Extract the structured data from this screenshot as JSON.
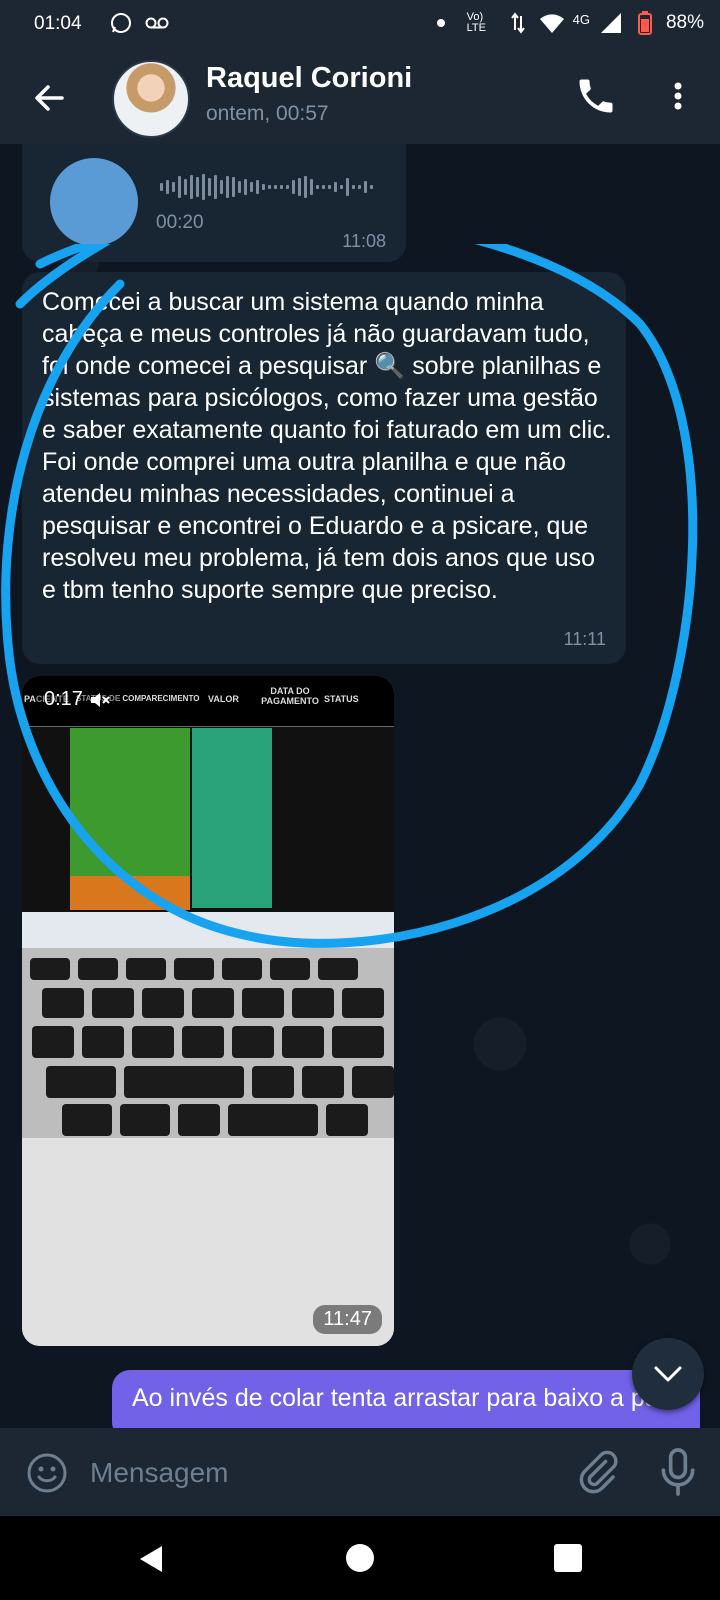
{
  "status_bar": {
    "time": "01:04",
    "network_label": "Vo) LTE",
    "signal_label": "4G",
    "battery": "88%"
  },
  "header": {
    "contact_name": "Raquel Corioni",
    "last_seen": "ontem, 00:57",
    "icons": [
      "back-arrow-icon",
      "phone-icon",
      "more-vertical-icon"
    ]
  },
  "messages": [
    {
      "type": "voice",
      "direction": "incoming",
      "duration": "00:20",
      "time": "11:08"
    },
    {
      "type": "text",
      "direction": "incoming",
      "text": "Comecei a buscar um sistema quando minha cabeça e meus controles já não guardavam tudo, foi onde comecei a pesquisar 🔍 sobre planilhas e sistemas para psicólogos, como fazer uma gestão e saber exatamente quanto foi faturado em um clic. Foi onde comprei uma outra planilha e que não atendeu minhas necessidades, continuei a pesquisar e encontrei o Eduardo e a psicare, que resolveu meu problema, já tem dois anos que uso e tbm tenho suporte sempre que preciso.",
      "time": "11:11"
    },
    {
      "type": "video",
      "direction": "incoming",
      "counter": "0:17",
      "time": "11:47",
      "sheet_headers": [
        "PACIENTE",
        "STATUS DE COMPARECIMENTO",
        "VALOR",
        "DATA DO PAGAMENTO",
        "STATUS"
      ]
    },
    {
      "type": "text",
      "direction": "outgoing",
      "text": "Ao invés de colar tenta arrastar para baixo a partir da célula de cima"
    }
  ],
  "composer": {
    "placeholder": "Mensagem"
  },
  "colors": {
    "background": "#0e1621",
    "header": "#1c2733",
    "incoming_bubble": "#182533",
    "outgoing_bubble": "#7262e8",
    "annotation_circle": "#18a3f0"
  }
}
